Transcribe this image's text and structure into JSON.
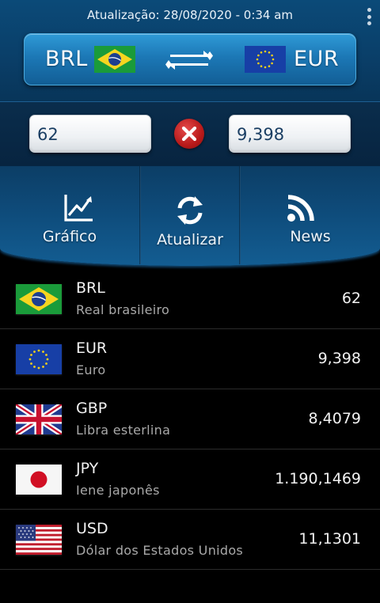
{
  "header": {
    "updated_text": "Atualização: 28/08/2020 - 0:34 am",
    "from_code": "BRL",
    "to_code": "EUR"
  },
  "converter": {
    "from_value": "62",
    "to_value": "9,398"
  },
  "actions": {
    "chart_label": "Gráfico",
    "refresh_label": "Atualizar",
    "news_label": "News"
  },
  "currencies": [
    {
      "code": "BRL",
      "name": "Real brasileiro",
      "value": "62",
      "flag": "brazil-flag"
    },
    {
      "code": "EUR",
      "name": "Euro",
      "value": "9,398",
      "flag": "eu-flag"
    },
    {
      "code": "GBP",
      "name": "Libra esterlina",
      "value": "8,4079",
      "flag": "uk-flag"
    },
    {
      "code": "JPY",
      "name": "Iene japonês",
      "value": "1.190,1469",
      "flag": "japan-flag"
    },
    {
      "code": "USD",
      "name": "Dólar dos Estados Unidos",
      "value": "11,1301",
      "flag": "usa-flag"
    }
  ],
  "colors": {
    "header_blue": "#0a3f69",
    "bar_blue": "#1c78b6",
    "clear_red": "#c81e1e",
    "input_text": "#1a3e63"
  }
}
